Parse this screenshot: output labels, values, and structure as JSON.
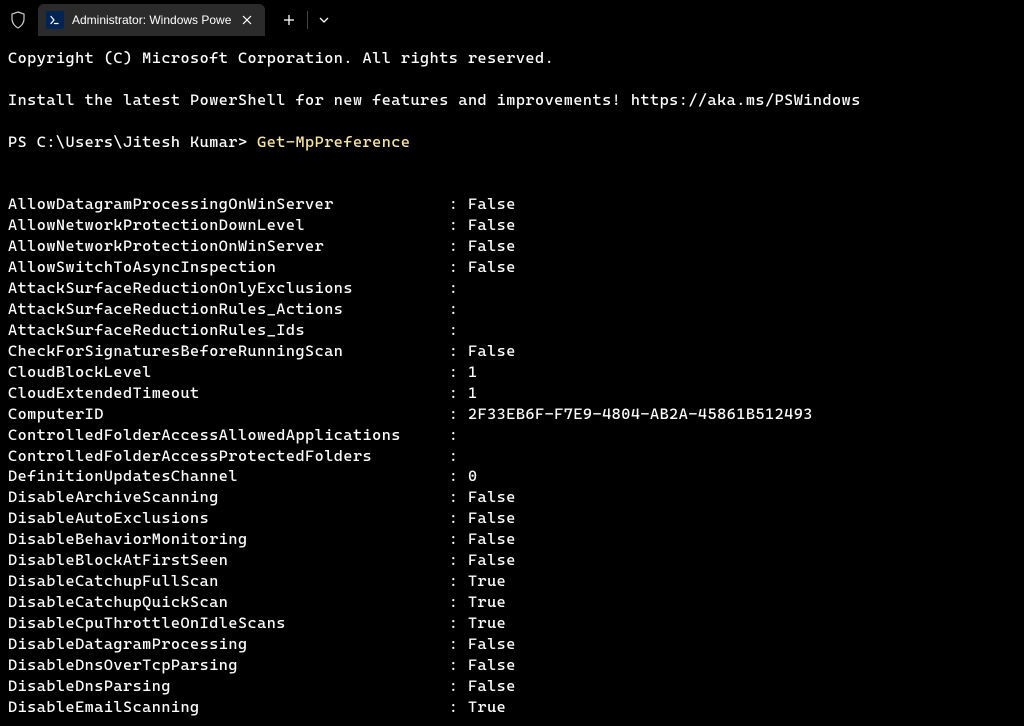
{
  "titlebar": {
    "tab_title": "Administrator: Windows Powe",
    "tab_icon_text": ">_"
  },
  "terminal": {
    "copyright": "Copyright (C) Microsoft Corporation. All rights reserved.",
    "install_msg": "Install the latest PowerShell for new features and improvements! https://aka.ms/PSWindows",
    "prompt": "PS C:\\Users\\Jitesh Kumar> ",
    "command": "Get-MpPreference",
    "output": [
      {
        "key": "AllowDatagramProcessingOnWinServer",
        "value": "False"
      },
      {
        "key": "AllowNetworkProtectionDownLevel",
        "value": "False"
      },
      {
        "key": "AllowNetworkProtectionOnWinServer",
        "value": "False"
      },
      {
        "key": "AllowSwitchToAsyncInspection",
        "value": "False"
      },
      {
        "key": "AttackSurfaceReductionOnlyExclusions",
        "value": ""
      },
      {
        "key": "AttackSurfaceReductionRules_Actions",
        "value": ""
      },
      {
        "key": "AttackSurfaceReductionRules_Ids",
        "value": ""
      },
      {
        "key": "CheckForSignaturesBeforeRunningScan",
        "value": "False"
      },
      {
        "key": "CloudBlockLevel",
        "value": "1"
      },
      {
        "key": "CloudExtendedTimeout",
        "value": "1"
      },
      {
        "key": "ComputerID",
        "value": "2F33EB6F-F7E9-4804-AB2A-45861B512493"
      },
      {
        "key": "ControlledFolderAccessAllowedApplications",
        "value": ""
      },
      {
        "key": "ControlledFolderAccessProtectedFolders",
        "value": ""
      },
      {
        "key": "DefinitionUpdatesChannel",
        "value": "0"
      },
      {
        "key": "DisableArchiveScanning",
        "value": "False"
      },
      {
        "key": "DisableAutoExclusions",
        "value": "False"
      },
      {
        "key": "DisableBehaviorMonitoring",
        "value": "False"
      },
      {
        "key": "DisableBlockAtFirstSeen",
        "value": "False"
      },
      {
        "key": "DisableCatchupFullScan",
        "value": "True"
      },
      {
        "key": "DisableCatchupQuickScan",
        "value": "True"
      },
      {
        "key": "DisableCpuThrottleOnIdleScans",
        "value": "True"
      },
      {
        "key": "DisableDatagramProcessing",
        "value": "False"
      },
      {
        "key": "DisableDnsOverTcpParsing",
        "value": "False"
      },
      {
        "key": "DisableDnsParsing",
        "value": "False"
      },
      {
        "key": "DisableEmailScanning",
        "value": "True"
      }
    ],
    "key_column_width": 46
  }
}
